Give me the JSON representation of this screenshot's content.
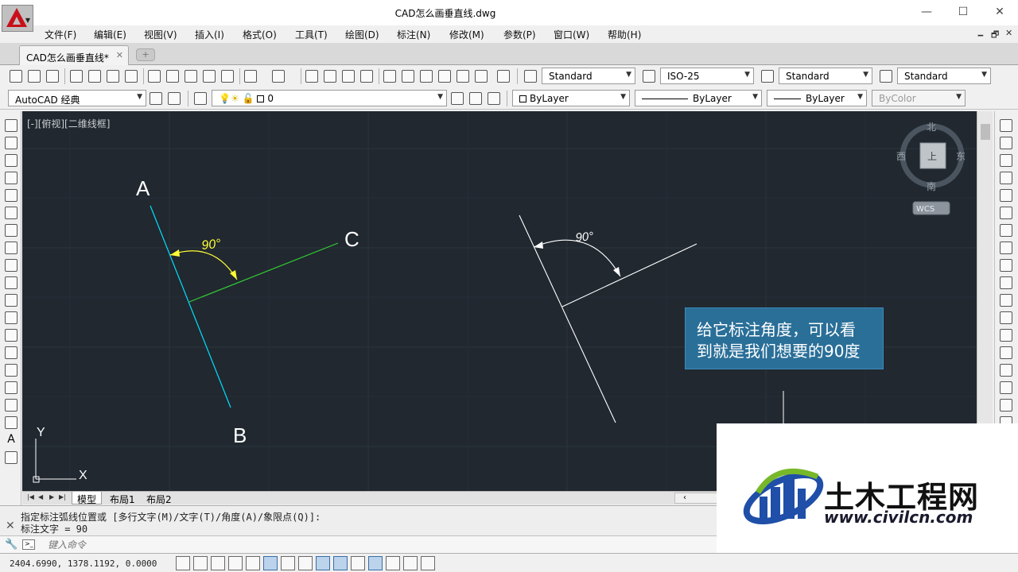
{
  "window": {
    "title": "CAD怎么画垂直线.dwg",
    "controls": [
      "—",
      "☐",
      "✕"
    ]
  },
  "menu": {
    "items": [
      "文件(F)",
      "编辑(E)",
      "视图(V)",
      "插入(I)",
      "格式(O)",
      "工具(T)",
      "绘图(D)",
      "标注(N)",
      "修改(M)",
      "参数(P)",
      "窗口(W)",
      "帮助(H)"
    ],
    "mdi_controls": [
      "🗕",
      "🗗",
      "✕"
    ]
  },
  "tabs": {
    "document": "CAD怎么画垂直线*",
    "close": "✕"
  },
  "toolbar1": {
    "text_style": "Standard",
    "dim_style": "ISO-25",
    "table_style": "Standard",
    "multileader_style": "Standard"
  },
  "toolbar2": {
    "workspace": "AutoCAD 经典",
    "layer": "0",
    "color": "ByLayer",
    "linetype": "ByLayer",
    "lineweight": "ByLayer",
    "plot_style": "ByColor"
  },
  "canvas": {
    "view_label": "[-][俯视][二维线框]",
    "labels": {
      "a": "A",
      "b": "B",
      "c": "C"
    },
    "angle_left": "90°",
    "angle_right": "90°",
    "ucs": {
      "y": "Y",
      "x": "X"
    },
    "viewcube": {
      "north": "北",
      "south": "南",
      "east": "东",
      "west": "西",
      "top": "上",
      "wcs": "WCS"
    },
    "colors": {
      "background": "#212830",
      "line_ab": "#00e0ff",
      "line_c": "#33cc33",
      "dimension": "#ffff33",
      "white_lines": "#ffffff"
    }
  },
  "annotation": {
    "line1": "给它标注角度，可以看",
    "line2": "到就是我们想要的90度"
  },
  "layout_tabs": [
    "模型",
    "布局1",
    "布局2"
  ],
  "command": {
    "history": [
      "指定标注弧线位置或 [多行文字(M)/文字(T)/角度(A)/象限点(Q)]:",
      "标注文字 = 90"
    ],
    "placeholder": "键入命令"
  },
  "status": {
    "coordinates": "2404.6990, 1378.1192, 0.0000"
  },
  "watermark": {
    "title": "土木工程网",
    "url": "www.civilcn.com"
  }
}
